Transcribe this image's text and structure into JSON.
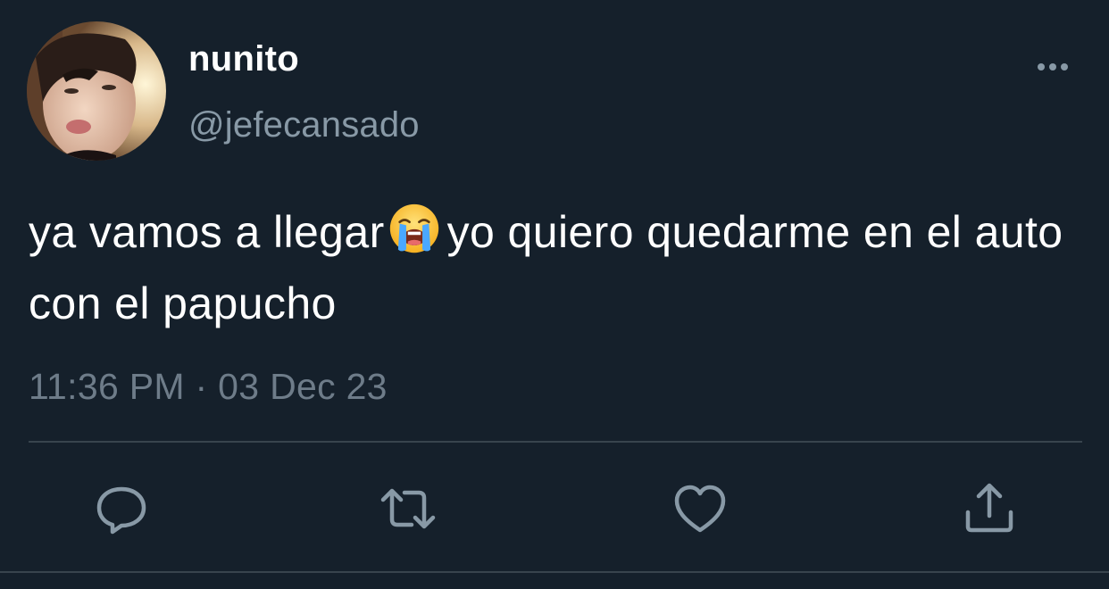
{
  "author": {
    "display_name": "nunito",
    "handle": "@jefecansado"
  },
  "tweet": {
    "text_before_emoji": "ya vamos a llegar",
    "emoji": "loudly-crying-face",
    "text_after_emoji": "yo quiero quedarme en el auto con el papucho",
    "timestamp": "11:36 PM · 03 Dec 23"
  },
  "actions": [
    "reply-icon",
    "retweet-icon",
    "like-icon",
    "share-icon"
  ],
  "colors": {
    "background": "#15202b",
    "primary_text": "#ffffff",
    "secondary_text": "#8899a6",
    "divider": "#38444d"
  }
}
